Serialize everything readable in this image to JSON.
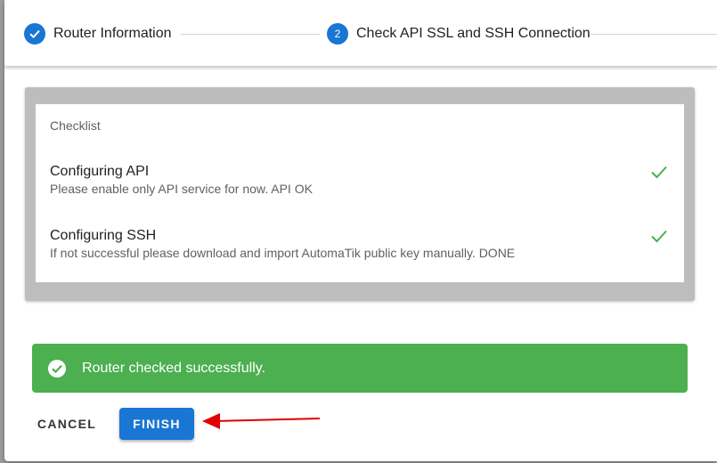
{
  "stepper": {
    "steps": [
      {
        "label": "Router Information",
        "state": "completed",
        "icon": "check-icon"
      },
      {
        "label": "Check API SSL and SSH Connection",
        "state": "active",
        "number": "2"
      }
    ]
  },
  "checklist": {
    "title": "Checklist",
    "items": [
      {
        "title": "Configuring API",
        "subtitle": "Please enable only API service for now. API OK",
        "status_icon": "check-icon"
      },
      {
        "title": "Configuring SSH",
        "subtitle": "If not successful please download and import AutomaTik public key manually. DONE",
        "status_icon": "check-icon"
      }
    ]
  },
  "alert": {
    "text": "Router checked successfully.",
    "icon": "check-circle-icon",
    "color": "#4caf50"
  },
  "actions": {
    "cancel_label": "CANCEL",
    "finish_label": "FINISH"
  },
  "colors": {
    "primary": "#1976d2",
    "success": "#4caf50",
    "annotation_arrow": "#e00000"
  }
}
